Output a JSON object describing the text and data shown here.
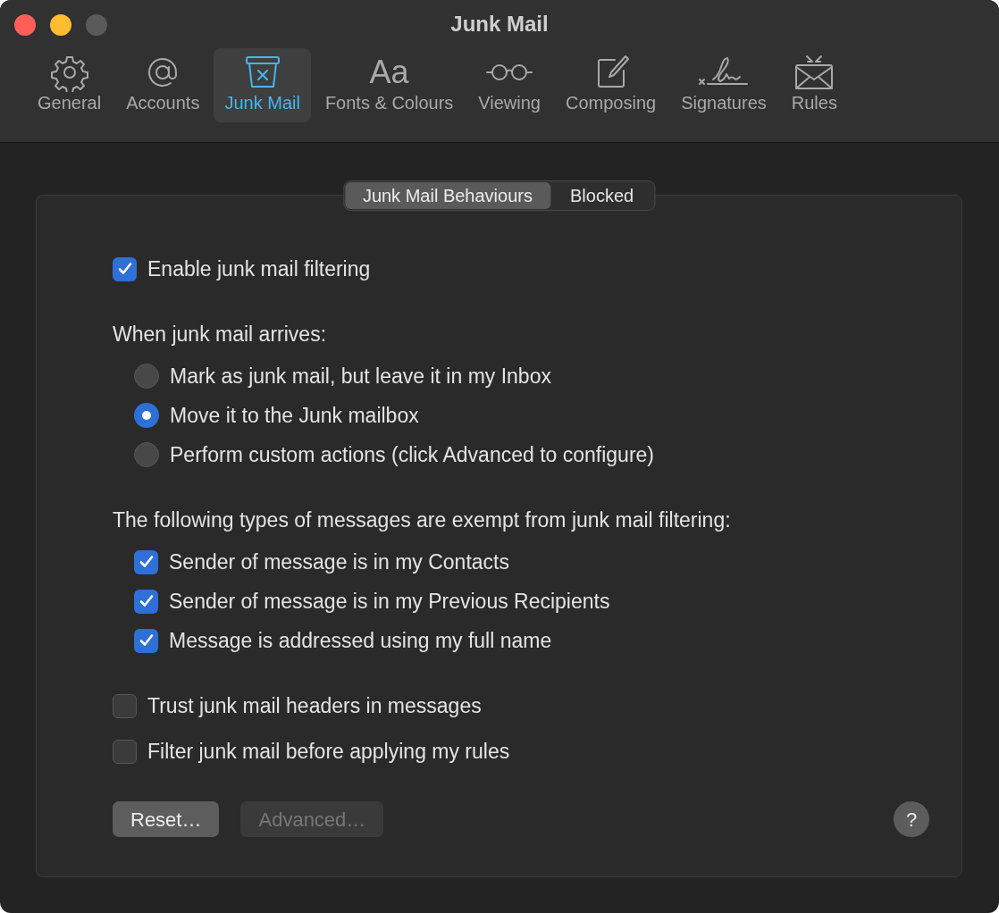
{
  "window": {
    "title": "Junk Mail"
  },
  "toolbar": {
    "items": [
      {
        "label": "General",
        "selected": false
      },
      {
        "label": "Accounts",
        "selected": false
      },
      {
        "label": "Junk Mail",
        "selected": true
      },
      {
        "label": "Fonts & Colours",
        "selected": false,
        "glyph": "Aa"
      },
      {
        "label": "Viewing",
        "selected": false
      },
      {
        "label": "Composing",
        "selected": false
      },
      {
        "label": "Signatures",
        "selected": false
      },
      {
        "label": "Rules",
        "selected": false
      }
    ]
  },
  "segments": [
    {
      "label": "Junk Mail Behaviours",
      "selected": true
    },
    {
      "label": "Blocked",
      "selected": false
    }
  ],
  "options": [
    {
      "kind": "checkbox",
      "label": "Enable junk mail filtering",
      "checked": true
    },
    {
      "kind": "group",
      "label": "When junk mail arrives:",
      "children": [
        {
          "kind": "radio",
          "label": "Mark as junk mail, but leave it in my Inbox",
          "selected": false
        },
        {
          "kind": "radio",
          "label": "Move it to the Junk mailbox",
          "selected": true
        },
        {
          "kind": "radio",
          "label": "Perform custom actions (click Advanced to configure)",
          "selected": false
        }
      ]
    },
    {
      "kind": "group",
      "label": "The following types of messages are exempt from junk mail filtering:",
      "children": [
        {
          "kind": "checkbox",
          "label": "Sender of message is in my Contacts",
          "checked": true
        },
        {
          "kind": "checkbox",
          "label": "Sender of message is in my Previous Recipients",
          "checked": true
        },
        {
          "kind": "checkbox",
          "label": "Message is addressed using my full name",
          "checked": true
        }
      ]
    },
    {
      "kind": "checkbox",
      "label": "Trust junk mail headers in messages",
      "checked": false
    },
    {
      "kind": "checkbox",
      "label": "Filter junk mail before applying my rules",
      "checked": false
    }
  ],
  "buttons": [
    {
      "label": "Reset…",
      "disabled": false
    },
    {
      "label": "Advanced…",
      "disabled": true
    }
  ],
  "help": {
    "label": "?"
  }
}
